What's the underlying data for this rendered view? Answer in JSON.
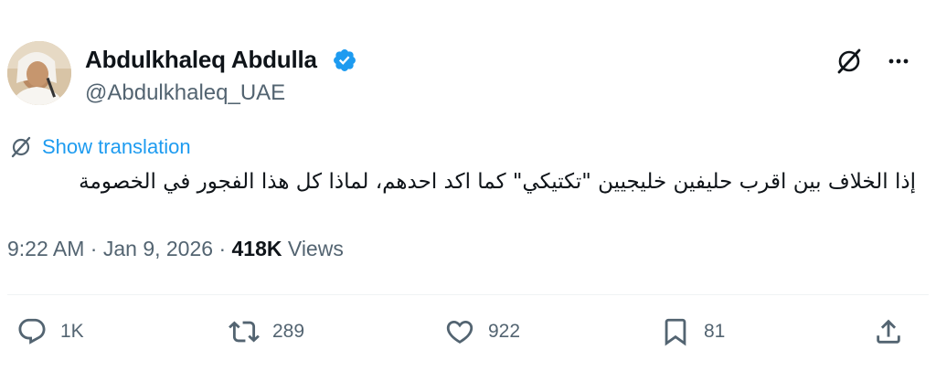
{
  "author": {
    "display_name": "Abdulkhaleq Abdulla",
    "handle": "@Abdulkhaleq_UAE",
    "verified": true
  },
  "header_actions": [
    "grok-icon",
    "more-icon"
  ],
  "translation": {
    "link_label": "Show translation"
  },
  "tweet": {
    "text": "إذا الخلاف بين اقرب حليفين خليجيين \"تكتيكي\" كما اكد احدهم، لماذا كل هذا الفجور في الخصومة"
  },
  "meta": {
    "time": "9:22 AM",
    "separator1": " · ",
    "date": "Jan 9, 2026",
    "separator2": " · ",
    "views_count": "418K",
    "views_label": " Views"
  },
  "actions": {
    "reply_count": "1K",
    "repost_count": "289",
    "like_count": "922",
    "bookmark_count": "81"
  },
  "colors": {
    "link_blue": "#1d9bf0",
    "verified_blue": "#1d9bf0",
    "secondary_text": "#536471",
    "primary_text": "#0f1419"
  }
}
